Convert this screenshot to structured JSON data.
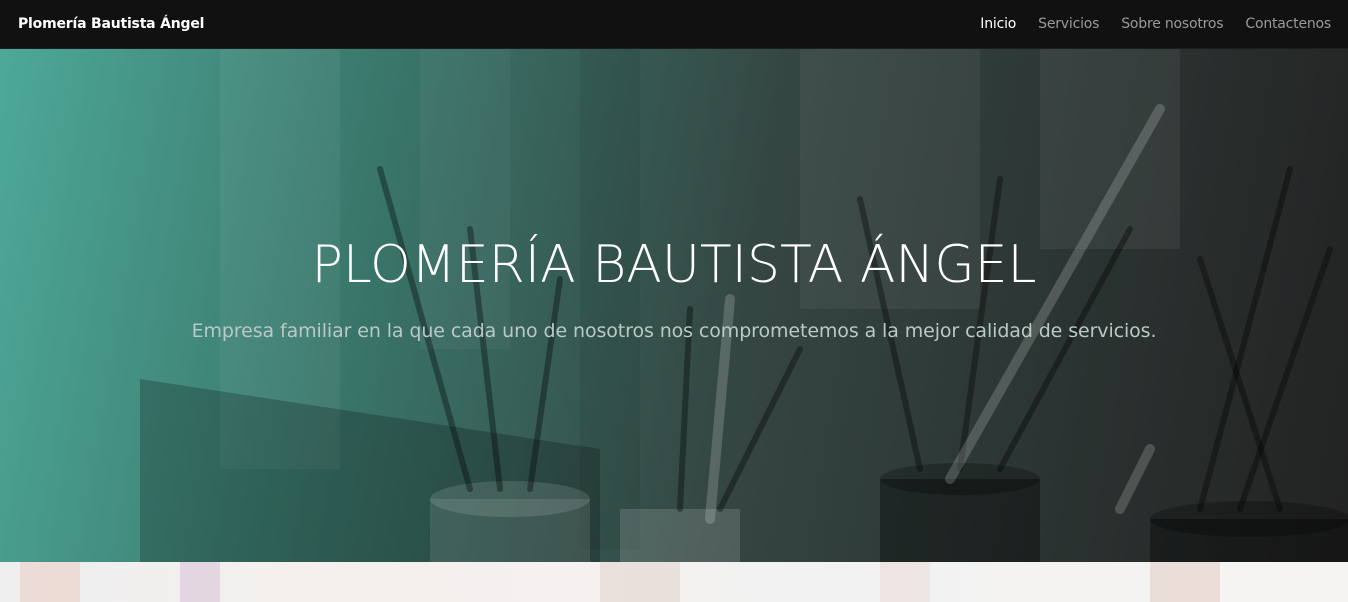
{
  "navbar": {
    "brand": "Plomería Bautista Ángel",
    "links": [
      {
        "label": "Inicio",
        "active": true
      },
      {
        "label": "Servicios",
        "active": false
      },
      {
        "label": "Sobre nosotros",
        "active": false
      },
      {
        "label": "Contactenos",
        "active": false
      }
    ]
  },
  "hero": {
    "title": "PLOMERÍA BAUTISTA ÁNGEL",
    "subtitle": "Empresa familiar en la que cada uno de nosotros nos comprometemos a la mejor calidad de servicios.",
    "overlay_colors": {
      "start": "#4fb2a0",
      "end": "#1e1e1e"
    }
  },
  "colors": {
    "navbar_bg": "#111111",
    "nav_active": "#ffffff",
    "nav_inactive": "#9a9a9a"
  }
}
